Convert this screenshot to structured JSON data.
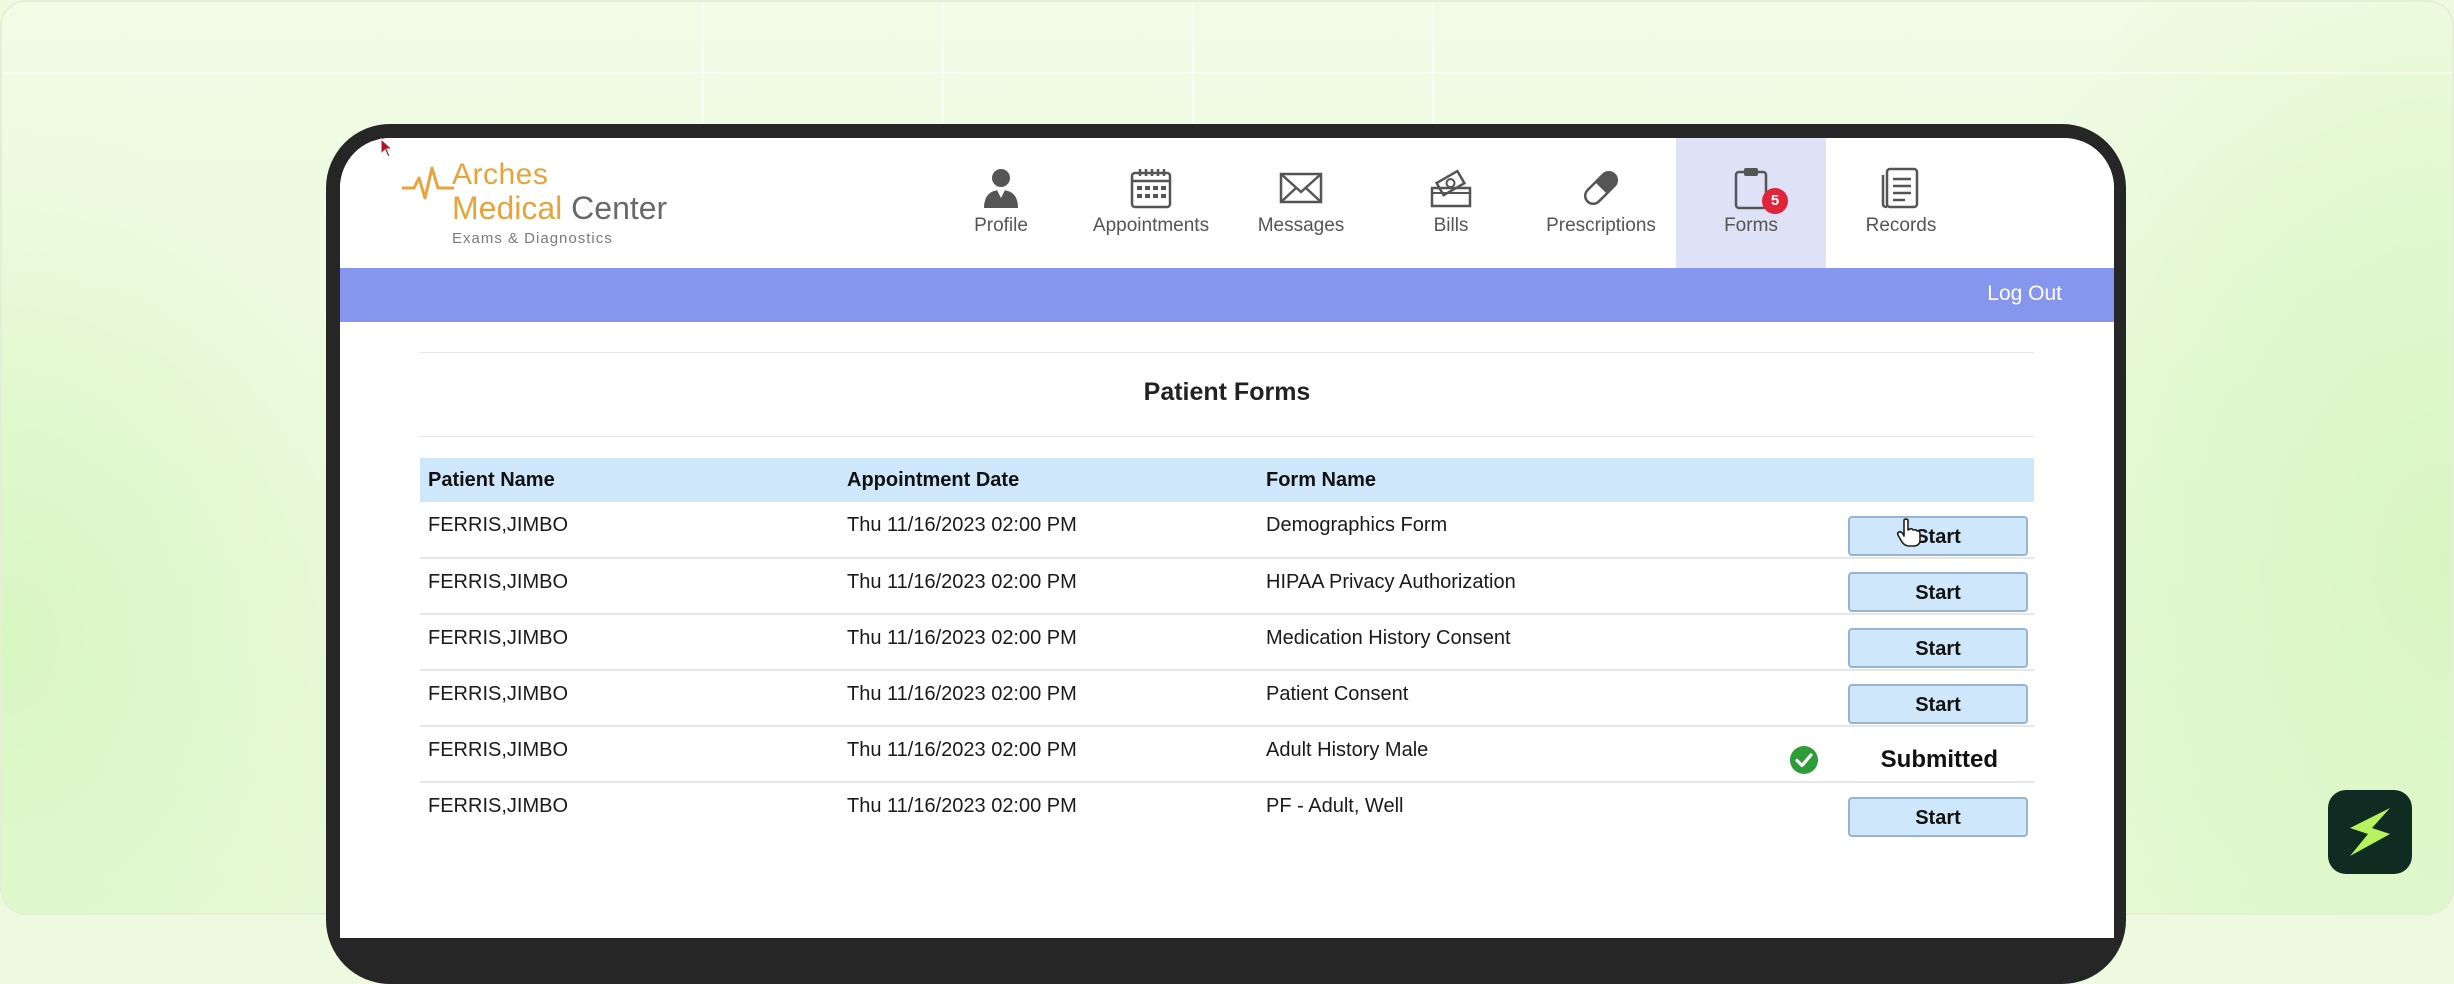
{
  "logo": {
    "line1": "Arches",
    "line2_a": "Medical",
    "line2_b": " Center",
    "tagline": "Exams & Diagnostics",
    "color_orange": "#e8a33a"
  },
  "nav": [
    {
      "label": "Profile",
      "icon": "person-icon"
    },
    {
      "label": "Appointments",
      "icon": "calendar-icon"
    },
    {
      "label": "Messages",
      "icon": "envelope-icon"
    },
    {
      "label": "Bills",
      "icon": "money-icon"
    },
    {
      "label": "Prescriptions",
      "icon": "pill-icon"
    },
    {
      "label": "Forms",
      "icon": "clipboard-icon",
      "badge": "5",
      "active": true
    },
    {
      "label": "Records",
      "icon": "document-icon"
    }
  ],
  "topbar": {
    "logout": "Log Out",
    "color": "#8696ef"
  },
  "page": {
    "title": "Patient Forms"
  },
  "table": {
    "headers": [
      "Patient Name",
      "Appointment Date",
      "Form Name",
      ""
    ],
    "rows": [
      {
        "patient": "FERRIS,JIMBO",
        "date": "Thu 11/16/2023 02:00 PM",
        "form": "Demographics Form",
        "action": "Start"
      },
      {
        "patient": "FERRIS,JIMBO",
        "date": "Thu 11/16/2023 02:00 PM",
        "form": "HIPAA Privacy Authorization",
        "action": "Start"
      },
      {
        "patient": "FERRIS,JIMBO",
        "date": "Thu 11/16/2023 02:00 PM",
        "form": "Medication History Consent",
        "action": "Start"
      },
      {
        "patient": "FERRIS,JIMBO",
        "date": "Thu 11/16/2023 02:00 PM",
        "form": "Patient Consent",
        "action": "Start"
      },
      {
        "patient": "FERRIS,JIMBO",
        "date": "Thu 11/16/2023 02:00 PM",
        "form": "Adult History Male",
        "status": "Submitted"
      },
      {
        "patient": "FERRIS,JIMBO",
        "date": "Thu 11/16/2023 02:00 PM",
        "form": "PF - Adult, Well",
        "action": "Start"
      }
    ]
  },
  "colors": {
    "header_row": "#cfe7fb",
    "active_tab": "#dfe1f7",
    "badge": "#e0243a",
    "check": "#2e9d38"
  }
}
